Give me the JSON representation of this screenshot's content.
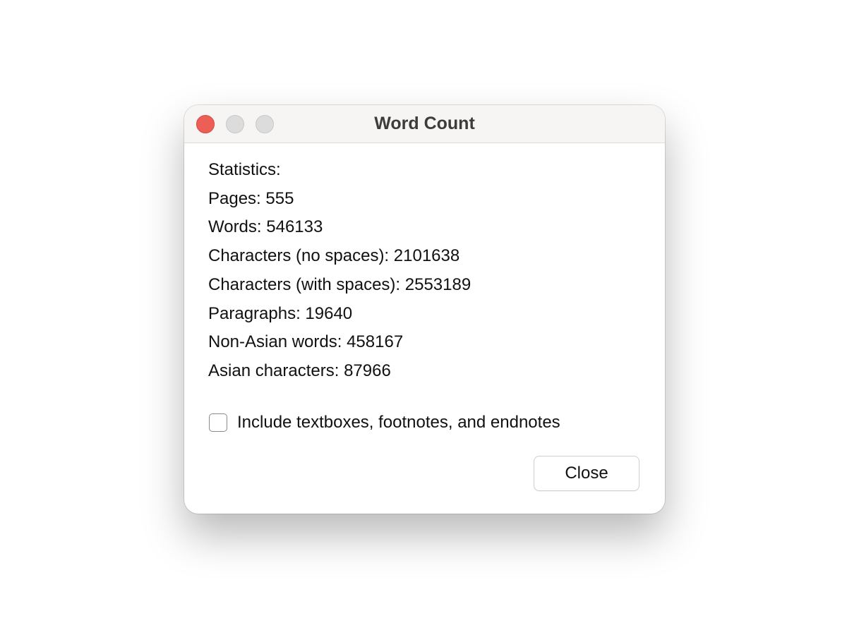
{
  "window": {
    "title": "Word Count"
  },
  "statistics": {
    "heading": "Statistics:",
    "lines": [
      "Pages: 555",
      "Words: 546133",
      "Characters (no spaces): 2101638",
      "Characters (with spaces): 2553189",
      "Paragraphs: 19640",
      "Non-Asian words: 458167",
      "Asian characters: 87966"
    ]
  },
  "options": {
    "include_label": "Include textboxes, footnotes, and endnotes",
    "include_checked": false
  },
  "buttons": {
    "close_label": "Close"
  },
  "colors": {
    "close_light": "#ec5f57",
    "inactive_light": "#dcdcdc"
  }
}
